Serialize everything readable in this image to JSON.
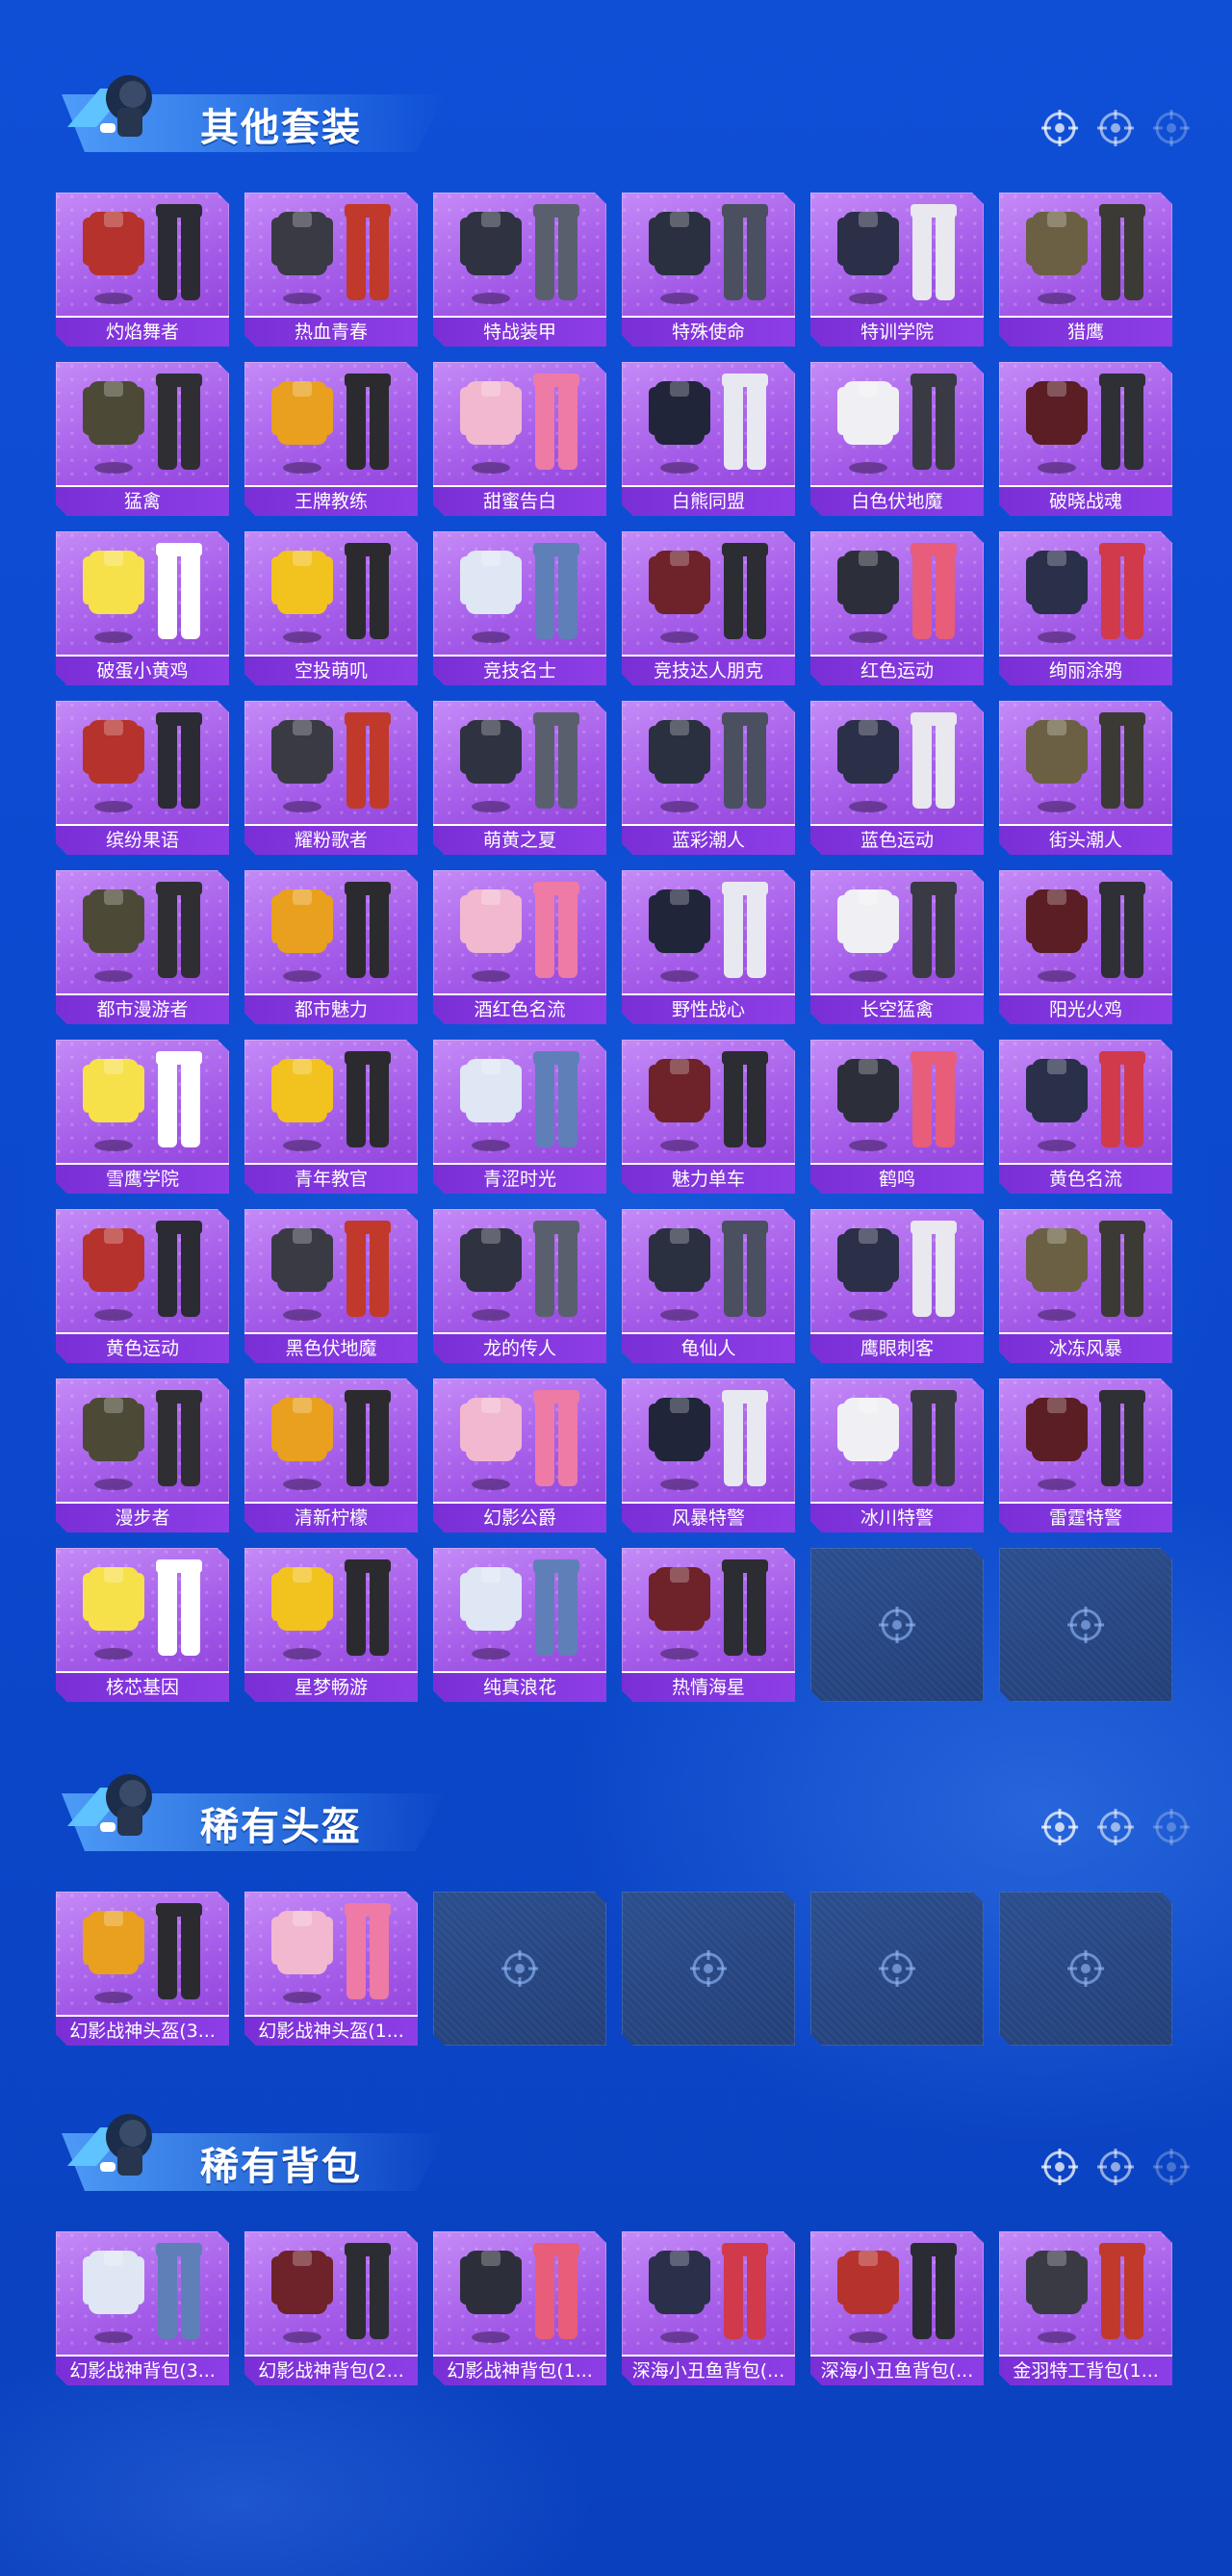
{
  "sections": [
    {
      "title": "其他套装",
      "items": [
        "灼焰舞者",
        "热血青春",
        "特战装甲",
        "特殊使命",
        "特训学院",
        "猎鹰",
        "猛禽",
        "王牌教练",
        "甜蜜告白",
        "白熊同盟",
        "白色伏地魔",
        "破晓战魂",
        "破蛋小黄鸡",
        "空投萌叽",
        "竞技名士",
        "竞技达人朋克",
        "红色运动",
        "绚丽涂鸦",
        "缤纷果语",
        "耀粉歌者",
        "萌黄之夏",
        "蓝彩潮人",
        "蓝色运动",
        "街头潮人",
        "都市漫游者",
        "都市魅力",
        "酒红色名流",
        "野性战心",
        "长空猛禽",
        "阳光火鸡",
        "雪鹰学院",
        "青年教官",
        "青涩时光",
        "魅力单车",
        "鹤鸣",
        "黄色名流",
        "黄色运动",
        "黑色伏地魔",
        "龙的传人",
        "龟仙人",
        "鹰眼刺客",
        "冰冻风暴",
        "漫步者",
        "清新柠檬",
        "幻影公爵",
        "风暴特警",
        "冰川特警",
        "雷霆特警",
        "核芯基因",
        "星梦畅游",
        "纯真浪花",
        "热情海星"
      ],
      "empty_slots": 2
    },
    {
      "title": "稀有头盔",
      "items": [
        "幻影战神头盔(3...",
        "幻影战神头盔(1..."
      ],
      "empty_slots": 4
    },
    {
      "title": "稀有背包",
      "items": [
        "幻影战神背包(3...",
        "幻影战神背包(2...",
        "幻影战神背包(1...",
        "深海小丑鱼背包(...",
        "深海小丑鱼背包(...",
        "金羽特工背包(1..."
      ],
      "empty_slots": 0
    }
  ],
  "colors": {
    "card_purple": "#a35ae8",
    "label_purple": "#7a2fd6",
    "empty_slot": "#2a4e8e",
    "background_blue": "#0c4ad0"
  },
  "icons": {
    "section_header": [
      "target-icon",
      "target-icon",
      "target-icon"
    ],
    "empty_slot": "target-icon",
    "mascot": "soldier-mascot-icon"
  }
}
